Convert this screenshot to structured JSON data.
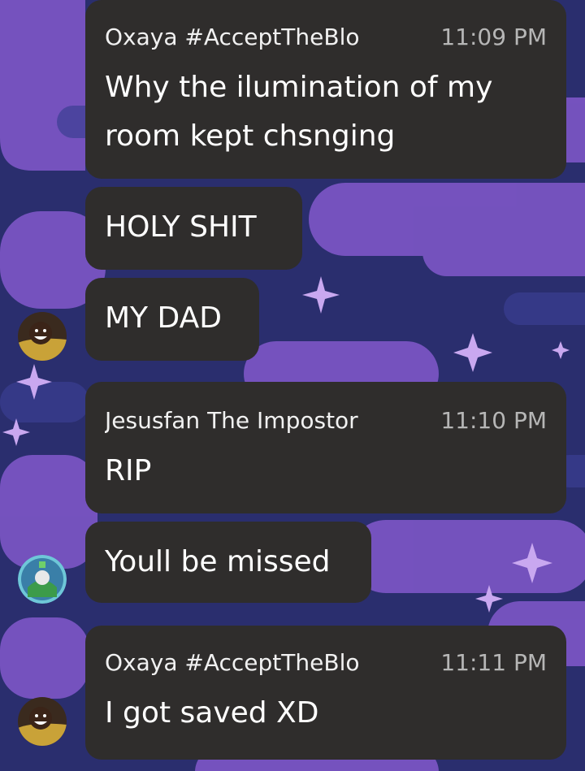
{
  "messages": [
    {
      "name": "Oxaya #AcceptTheBlo",
      "time": "11:09 PM",
      "lines": [
        "Why the ilumination of my",
        "room kept chsnging"
      ]
    },
    {
      "text": "HOLY SHIT"
    },
    {
      "text": "MY DAD"
    },
    {
      "name": "Jesusfan The Impostor",
      "time": "11:10 PM",
      "text": "RIP"
    },
    {
      "text": "Youll be missed"
    },
    {
      "name": "Oxaya #AcceptTheBlo",
      "time": "11:11 PM",
      "text": "I got saved XD"
    }
  ],
  "avatars": [
    "oxaya-avatar-icon",
    "jesusfan-avatar-icon",
    "oxaya-avatar-icon"
  ],
  "colors": {
    "bubble": "#2f2d2c",
    "background": "#2a2e6e",
    "wallpaper_accent": "#7d57c6",
    "timestamp": "#b6b6b6",
    "text": "#ffffff"
  }
}
